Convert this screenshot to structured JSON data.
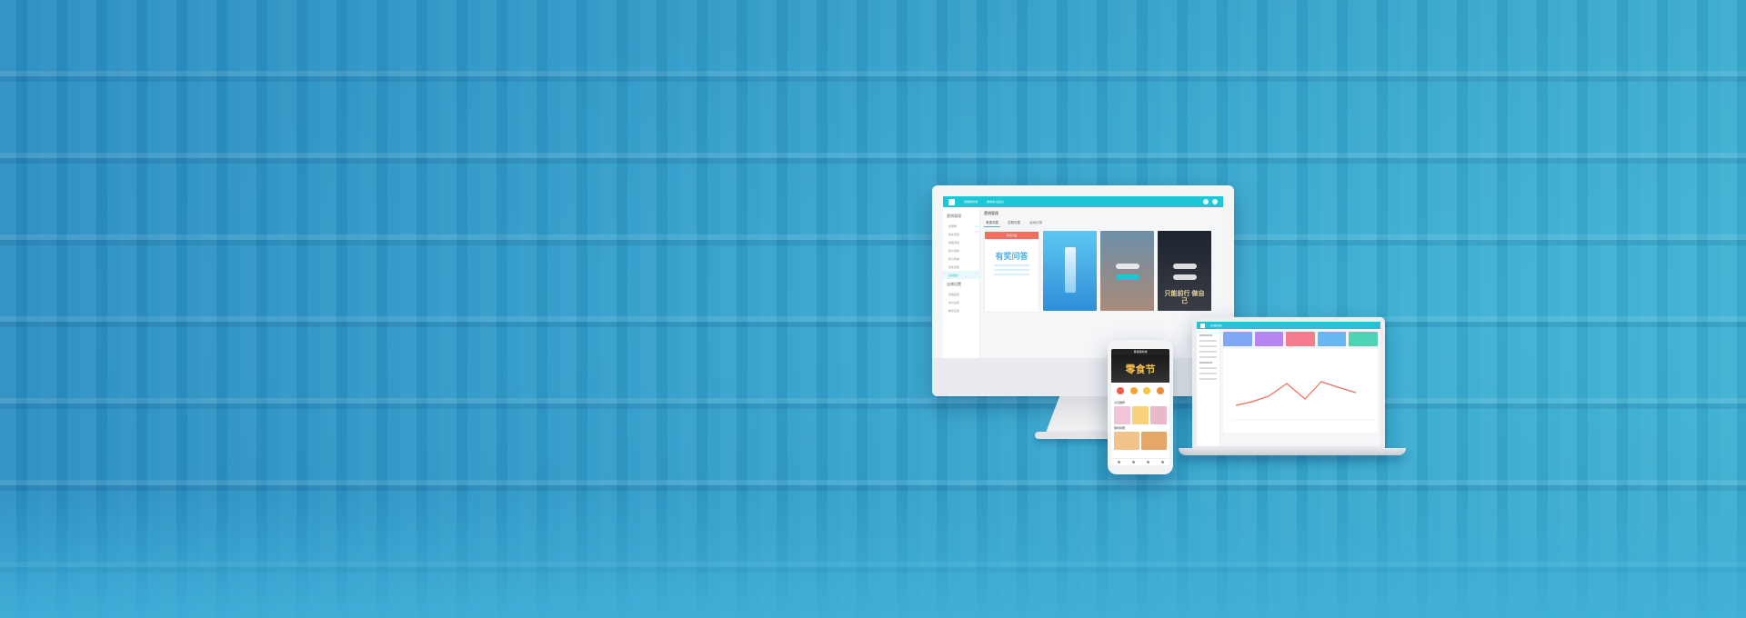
{
  "desktop": {
    "brand_text": "易客微商城",
    "store_text": "微商城 总后台",
    "page_title": "营销管理",
    "sidebar": {
      "group1": "营销管理",
      "items1": [
        "优惠券",
        "秒杀活动",
        "拼团活动",
        "砍价活动",
        "积分商城",
        "有奖问答",
        "活动推广"
      ],
      "group2": "店铺设置",
      "items2": [
        "基础设置",
        "支付设置",
        "物流设置"
      ]
    },
    "tabs": [
      "有奖问答",
      "答题设置",
      "活动记录"
    ],
    "cards": {
      "quiz_header": "有奖问答",
      "quiz_title": "有奖问答",
      "c3_btn1": "开始",
      "c3_btn2": "规则",
      "c4_btn1": "开始",
      "c4_btn2": "规则",
      "c4_text": "只能前行 做自己"
    }
  },
  "laptop": {
    "brand_text": "易客微商城",
    "tile_colors": [
      "#7fa7f6",
      "#b685f0",
      "#f47c8c",
      "#6ab8f3",
      "#4fd3b5"
    ],
    "chart_color": "#f26b5b"
  },
  "phone": {
    "header": "易客微商城",
    "banner_text": "零食节",
    "section1": "今日推荐",
    "section2": "限时特惠",
    "icon_colors": [
      "#f0594a",
      "#f6a33a",
      "#f7c53c",
      "#f0883a"
    ]
  }
}
